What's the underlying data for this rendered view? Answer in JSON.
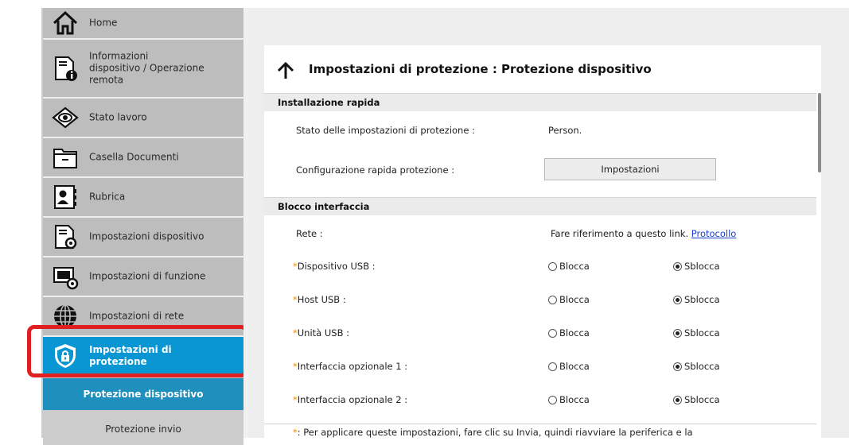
{
  "sidebar": {
    "items": [
      {
        "label": "Home",
        "icon": "home-icon"
      },
      {
        "label_lines": [
          "Informazioni",
          "dispositivo / Operazione",
          "remota"
        ],
        "icon": "device-info-icon"
      },
      {
        "label": "Stato lavoro",
        "icon": "eye-icon"
      },
      {
        "label": "Casella Documenti",
        "icon": "folder-icon"
      },
      {
        "label": "Rubrica",
        "icon": "address-book-icon"
      },
      {
        "label": "Impostazioni dispositivo",
        "icon": "device-settings-icon"
      },
      {
        "label": "Impostazioni di funzione",
        "icon": "function-settings-icon"
      },
      {
        "label": "Impostazioni di rete",
        "icon": "globe-icon"
      },
      {
        "label_lines": [
          "Impostazioni di",
          "protezione"
        ],
        "icon": "shield-lock-icon",
        "active": true
      }
    ],
    "subitems": [
      {
        "label": "Protezione dispositivo",
        "selected": true
      },
      {
        "label": "Protezione invio",
        "selected": false
      }
    ]
  },
  "page": {
    "title": "Impostazioni di protezione : Protezione dispositivo"
  },
  "quick_setup": {
    "header": "Installazione rapida",
    "status_label": "Stato delle impostazioni di protezione :",
    "status_value": "Person.",
    "config_label": "Configurazione rapida protezione :",
    "settings_button": "Impostazioni"
  },
  "interface_block": {
    "header": "Blocco interfaccia",
    "network_label": "Rete :",
    "network_text": "Fare riferimento a questo link.",
    "network_link": "Protocollo",
    "lock_label": "Blocca",
    "unlock_label": "Sblocca",
    "required_mark": "*",
    "rows": [
      {
        "label": "Dispositivo USB :",
        "value": "Sblocca"
      },
      {
        "label": "Host USB :",
        "value": "Sblocca"
      },
      {
        "label": "Unità USB :",
        "value": "Sblocca"
      },
      {
        "label": "Interfaccia opzionale 1 :",
        "value": "Sblocca"
      },
      {
        "label": "Interfaccia opzionale 2 :",
        "value": "Sblocca"
      }
    ]
  },
  "footnote": {
    "mark": "*",
    "text": ": Per applicare queste impostazioni, fare clic su Invia, quindi riavviare la periferica e la"
  },
  "colors": {
    "active_nav": "#0a96d2",
    "selected_sub": "#1f8fbd",
    "highlight": "#e02020",
    "link": "#1a3fd1",
    "required": "#f08c00"
  }
}
